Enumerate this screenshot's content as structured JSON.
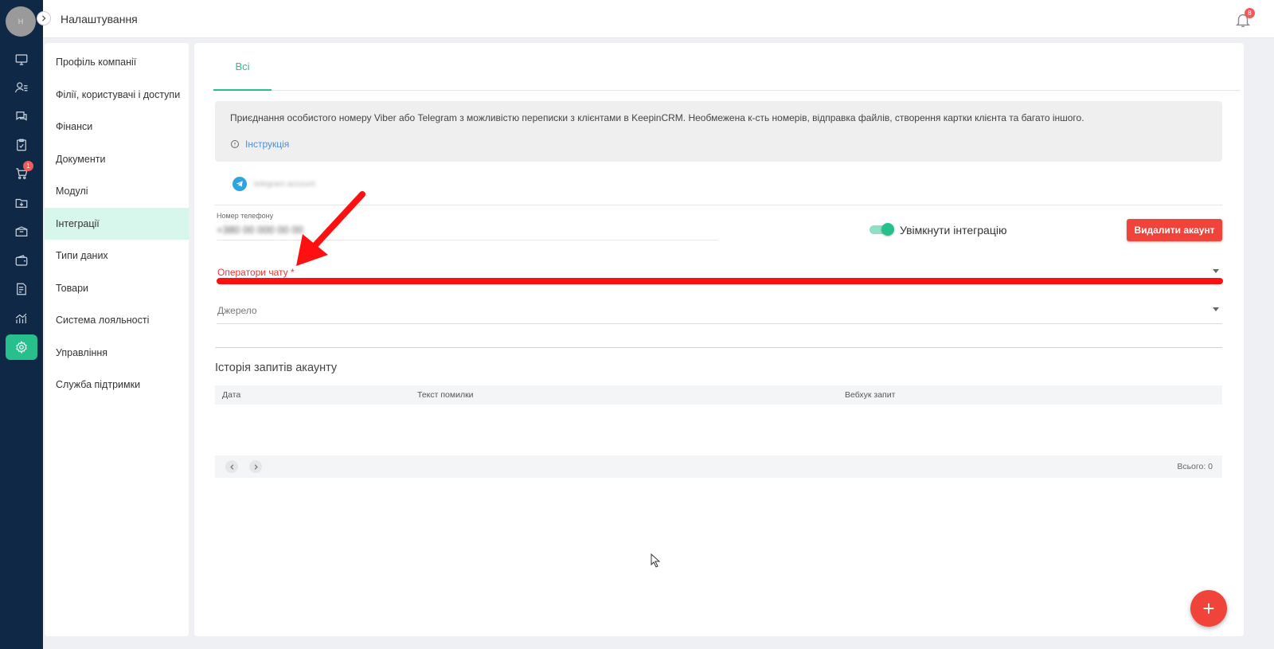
{
  "header": {
    "title": "Налаштування",
    "notification_count": "8"
  },
  "rail": {
    "avatar_text": "Н",
    "cart_badge": "1"
  },
  "settings_menu": {
    "items": [
      "Профіль компанії",
      "Філії, користувачі і доступи",
      "Фінанси",
      "Документи",
      "Модулі",
      "Інтеграції",
      "Типи даних",
      "Товари",
      "Система лояльності",
      "Управління",
      "Служба підтримки"
    ],
    "active_index": 5
  },
  "tabs": {
    "all": "Всі"
  },
  "info": {
    "text": "Приєднання особистого номеру Viber або Telegram з можливістю переписки з клієнтами в KeepinCRM. Необмежена к-сть номерів, відправка файлів, створення картки клієнта та багато іншого.",
    "instruction_link": "Інструкція"
  },
  "account": {
    "name": "telegram account",
    "phone_label": "Номер телефону",
    "phone_value": "+380 00 000 00 00"
  },
  "toggle": {
    "label": "Увімкнути інтеграцію",
    "enabled": true
  },
  "buttons": {
    "delete_account": "Видалити акаунт",
    "fab": "+"
  },
  "fields": {
    "chat_operators": "Оператори чату *",
    "source": "Джерело"
  },
  "history": {
    "title": "Історія запитів акаунту",
    "columns": [
      "Дата",
      "Текст помилки",
      "Вебхук запит"
    ],
    "total": "Всього: 0"
  },
  "colors": {
    "accent": "#27c08d",
    "danger": "#f0433a",
    "annotation": "#ff1010",
    "rail": "#0f2846"
  }
}
